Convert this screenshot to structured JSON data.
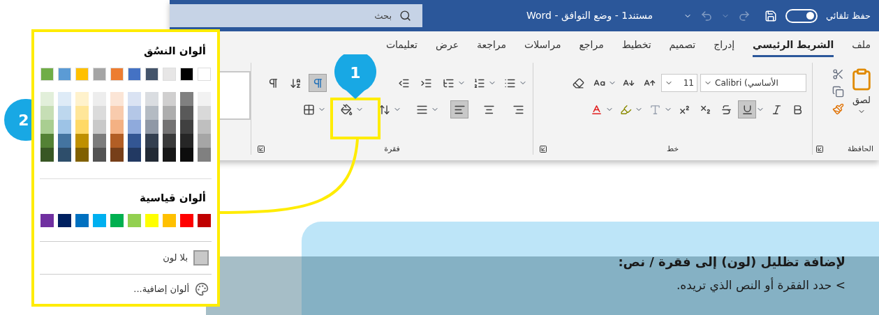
{
  "title_bar": {
    "autosave_label": "حفظ تلقائي",
    "autosave_on": true,
    "document_title": "مستند1  -  وضع التوافق  -  Word",
    "search": {
      "placeholder": "بحث"
    }
  },
  "tabs": [
    {
      "label": "ملف",
      "selected": false
    },
    {
      "label": "الشريط الرئيسي",
      "selected": true
    },
    {
      "label": "إدراج",
      "selected": false
    },
    {
      "label": "تصميم",
      "selected": false
    },
    {
      "label": "تخطيط",
      "selected": false
    },
    {
      "label": "مراجع",
      "selected": false
    },
    {
      "label": "مراسلات",
      "selected": false
    },
    {
      "label": "مراجعة",
      "selected": false
    },
    {
      "label": "عرض",
      "selected": false
    },
    {
      "label": "تعليمات",
      "selected": false
    }
  ],
  "ribbon": {
    "clipboard": {
      "paste_label": "لصق",
      "group_label": "الحافظة"
    },
    "font": {
      "font_name": "Calibri (الأساسي",
      "font_size": "11",
      "group_label": "خط",
      "row_1": [
        {
          "kind": "grow",
          "pressed": false,
          "menu": false
        },
        {
          "kind": "shrink",
          "pressed": false,
          "menu": false
        },
        {
          "kind": "case",
          "pressed": false,
          "menu": true
        },
        {
          "kind": "clear",
          "pressed": false,
          "menu": false
        }
      ],
      "row_2": [
        {
          "kind": "bold",
          "pressed": false,
          "menu": false
        },
        {
          "kind": "italic",
          "pressed": false,
          "menu": false
        },
        {
          "kind": "underline",
          "pressed": true,
          "menu": true
        },
        {
          "kind": "strike",
          "pressed": false,
          "menu": false
        },
        {
          "kind": "subscript",
          "pressed": false,
          "menu": false
        },
        {
          "kind": "superscript",
          "pressed": false,
          "menu": false
        },
        {
          "kind": "effects",
          "pressed": false,
          "menu": true
        },
        {
          "kind": "highlight",
          "pressed": false,
          "menu": true
        },
        {
          "kind": "fontcolor",
          "pressed": false,
          "menu": true
        }
      ]
    },
    "paragraph": {
      "group_label": "فقرة",
      "row_1": [
        {
          "kind": "bullets",
          "pressed": false,
          "menu": true
        },
        {
          "kind": "numbering",
          "pressed": false,
          "menu": true
        },
        {
          "kind": "multilevel",
          "pressed": false,
          "menu": true
        },
        {
          "kind": "indent",
          "pressed": false,
          "menu": false
        },
        {
          "kind": "outdent",
          "pressed": false,
          "menu": false
        },
        {
          "kind": "rtl",
          "pressed": true,
          "menu": false
        },
        {
          "kind": "sort",
          "pressed": false,
          "menu": false
        },
        {
          "kind": "pilcrow",
          "pressed": false,
          "menu": false
        }
      ],
      "row_2": [
        {
          "kind": "align_right",
          "pressed": false,
          "menu": false
        },
        {
          "kind": "align_center",
          "pressed": false,
          "menu": false
        },
        {
          "kind": "align_left",
          "pressed": true,
          "menu": false
        },
        {
          "kind": "justify",
          "pressed": false,
          "menu": true
        },
        {
          "kind": "spacing",
          "pressed": false,
          "menu": true
        },
        {
          "kind": "shading",
          "pressed": false,
          "menu": true
        },
        {
          "kind": "borders",
          "pressed": false,
          "menu": true
        }
      ]
    }
  },
  "color_menu": {
    "theme_heading": "ألوان النسُق",
    "theme_colors": [
      {
        "color": "#ffffff"
      },
      {
        "color": "#000000"
      },
      {
        "color": "#e7e6e6"
      },
      {
        "color": "#44546a"
      },
      {
        "color": "#4472c4"
      },
      {
        "color": "#ed7d31"
      },
      {
        "color": "#a5a5a5"
      },
      {
        "color": "#ffc000"
      },
      {
        "color": "#5b9bd5"
      },
      {
        "color": "#70ad47"
      }
    ],
    "standard_heading": "ألوان قياسية",
    "standard_colors": [
      {
        "color": "#c00000"
      },
      {
        "color": "#ff0000"
      },
      {
        "color": "#ffc000"
      },
      {
        "color": "#ffff00"
      },
      {
        "color": "#92d050"
      },
      {
        "color": "#00b050"
      },
      {
        "color": "#00b0f0"
      },
      {
        "color": "#0070c0"
      },
      {
        "color": "#002060"
      },
      {
        "color": "#7030a0"
      }
    ],
    "no_color": "بلا لون",
    "more_colors": "ألوان إضافية..."
  },
  "callouts": [
    "1",
    "2"
  ],
  "instruction_card": {
    "heading": "لإضافة تظليل (لون) إلى فقرة / نص:",
    "step": "> حدد الفقرة أو النص الذي تريده."
  }
}
